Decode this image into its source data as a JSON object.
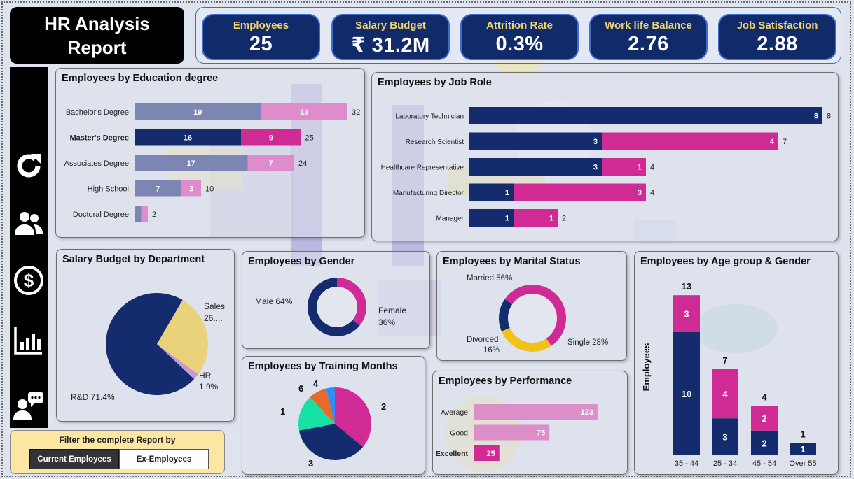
{
  "header": {
    "title_line1": "HR Analysis",
    "title_line2": "Report"
  },
  "kpis": [
    {
      "label": "Employees",
      "value": "25"
    },
    {
      "label": "Salary Budget",
      "value": "₹ 31.2M"
    },
    {
      "label": "Attrition Rate",
      "value": "0.3%"
    },
    {
      "label": "Work life Balance",
      "value": "2.76"
    },
    {
      "label": "Job Satisfaction",
      "value": "2.88"
    }
  ],
  "sidebar": {
    "icons": [
      "refresh-icon",
      "people-icon",
      "dollar-icon",
      "bar-chart-icon",
      "user-chat-icon"
    ]
  },
  "filter": {
    "title": "Filter the complete Report by",
    "option_current": "Current Employees",
    "option_ex": "Ex-Employees"
  },
  "colors": {
    "navy": "#142c6e",
    "magenta": "#d02a94",
    "gold": "#f2c21a",
    "teal": "#17e0a5",
    "orange": "#e86a2a",
    "blue": "#2f8ef0",
    "lavender": "#9a8be0",
    "kpi_label": "#f3d56b"
  },
  "chart_data": [
    {
      "id": "education",
      "type": "bar",
      "orientation": "horizontal",
      "stacked": true,
      "title": "Employees by Education degree",
      "categories": [
        "Bachelor's Degree",
        "Master's Degree",
        "Associates Degree",
        "High School",
        "Doctoral Degree"
      ],
      "series": [
        {
          "values": [
            19,
            16,
            17,
            7,
            1
          ]
        },
        {
          "values": [
            13,
            9,
            7,
            3,
            1
          ]
        }
      ],
      "totals": [
        32,
        25,
        24,
        10,
        2
      ],
      "data_labels_a": [
        "19",
        "16",
        "17",
        "7",
        ""
      ],
      "data_labels_b": [
        "13",
        "9",
        "7",
        "3",
        ""
      ],
      "total_labels": [
        "32",
        "25",
        "24",
        "10",
        "2"
      ],
      "highlighted_category": "Master's Degree"
    },
    {
      "id": "jobrole",
      "type": "bar",
      "orientation": "horizontal",
      "stacked": true,
      "title": "Employees by Job Role",
      "categories": [
        "Laboratory Technician",
        "Research Scientist",
        "Healthcare Representative",
        "Manufacturing Director",
        "Manager"
      ],
      "series": [
        {
          "values": [
            8,
            3,
            3,
            1,
            1
          ]
        },
        {
          "values": [
            0,
            4,
            1,
            3,
            1
          ]
        }
      ],
      "totals": [
        8,
        7,
        4,
        4,
        2
      ],
      "data_labels_a": [
        "8",
        "3",
        "3",
        "1",
        "1"
      ],
      "data_labels_b": [
        "",
        "4",
        "1",
        "3",
        "1"
      ],
      "total_labels": [
        "8",
        "7",
        "4",
        "4",
        "2"
      ]
    },
    {
      "id": "department",
      "type": "pie",
      "title": "Salary Budget by Department",
      "slices": [
        {
          "label": "R&D",
          "value": 71.4,
          "text": "R&D 71.4%"
        },
        {
          "label": "Sales",
          "value": 26.7,
          "text1": "Sales",
          "text2": "26...."
        },
        {
          "label": "HR",
          "value": 1.9,
          "text1": "HR",
          "text2": "1.9%"
        }
      ]
    },
    {
      "id": "gender",
      "type": "pie",
      "donut": true,
      "title": "Employees by Gender",
      "slices": [
        {
          "label": "Male",
          "value": 64,
          "text": "Male 64%"
        },
        {
          "label": "Female",
          "value": 36,
          "text1": "Female",
          "text2": "36%"
        }
      ]
    },
    {
      "id": "marital",
      "type": "pie",
      "donut": true,
      "title": "Employees by Marital Status",
      "slices": [
        {
          "label": "Married",
          "value": 56,
          "text": "Married 56%"
        },
        {
          "label": "Single",
          "value": 28,
          "text": "Single 28%"
        },
        {
          "label": "Divorced",
          "value": 16,
          "text1": "Divorced",
          "text2": "16%"
        }
      ]
    },
    {
      "id": "training",
      "type": "pie",
      "title": "Employees by Training Months",
      "slices": [
        {
          "label": "2",
          "value": 9
        },
        {
          "label": "3",
          "value": 9
        },
        {
          "label": "1",
          "value": 4
        },
        {
          "label": "6",
          "value": 2
        },
        {
          "label": "4",
          "value": 1
        }
      ]
    },
    {
      "id": "performance",
      "type": "bar",
      "orientation": "horizontal",
      "title": "Employees by Performance",
      "categories": [
        "Average",
        "Good",
        "Excellent"
      ],
      "values": [
        123,
        75,
        25
      ],
      "data_labels": [
        "123",
        "75",
        "25"
      ],
      "highlighted_category": "Excellent"
    },
    {
      "id": "agegroup",
      "type": "bar",
      "orientation": "vertical",
      "stacked": true,
      "title": "Employees by Age group & Gender",
      "ylabel": "Employees",
      "categories": [
        "35 - 44",
        "25 - 34",
        "45 - 54",
        "Over 55"
      ],
      "series": [
        {
          "values": [
            10,
            3,
            2,
            1
          ]
        },
        {
          "values": [
            3,
            4,
            2,
            0
          ]
        }
      ],
      "totals": [
        13,
        7,
        4,
        1
      ],
      "data_labels_a": [
        "10",
        "3",
        "2",
        "1"
      ],
      "data_labels_b": [
        "3",
        "4",
        "2",
        ""
      ],
      "total_labels": [
        "13",
        "7",
        "4",
        "1"
      ]
    }
  ]
}
